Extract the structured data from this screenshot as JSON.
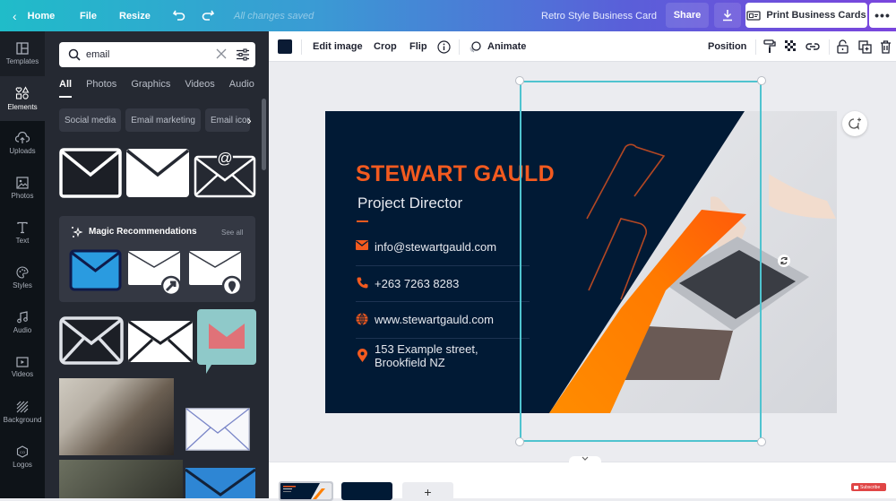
{
  "topbar": {
    "home": "Home",
    "file": "File",
    "resize": "Resize",
    "save_status": "All changes saved",
    "doc_title": "Retro Style Business Card",
    "share": "Share",
    "print": "Print Business Cards",
    "more": "•••"
  },
  "rail": {
    "items": [
      {
        "label": "Templates",
        "icon": "templates-icon"
      },
      {
        "label": "Elements",
        "icon": "elements-icon"
      },
      {
        "label": "Uploads",
        "icon": "upload-cloud-icon"
      },
      {
        "label": "Photos",
        "icon": "photos-icon"
      },
      {
        "label": "Text",
        "icon": "text-icon"
      },
      {
        "label": "Styles",
        "icon": "palette-icon"
      },
      {
        "label": "Audio",
        "icon": "music-icon"
      },
      {
        "label": "Videos",
        "icon": "video-icon"
      },
      {
        "label": "Background",
        "icon": "background-icon"
      },
      {
        "label": "Logos",
        "icon": "logo-icon"
      }
    ]
  },
  "panel": {
    "search_value": "email",
    "tabs": [
      "All",
      "Photos",
      "Graphics",
      "Videos",
      "Audio"
    ],
    "active_tab": "All",
    "chips": [
      "Social media",
      "Email marketing",
      "Email icon"
    ],
    "magic": {
      "title": "Magic Recommendations",
      "see_all": "See all"
    }
  },
  "context_toolbar": {
    "swatch_color": "#0b1b34",
    "edit_image": "Edit image",
    "crop": "Crop",
    "flip": "Flip",
    "animate": "Animate",
    "position": "Position"
  },
  "card": {
    "name": "STEWART GAULD",
    "role": "Project Director",
    "email": "info@stewartgauld.com",
    "phone": "+263 7263 8283",
    "website": "www.stewartgauld.com",
    "address_line1": "153 Example street,",
    "address_line2": "Brookfield NZ",
    "colors": {
      "navy": "#011a35",
      "orange": "#f35a1f"
    }
  },
  "pages": {
    "add": "+"
  },
  "overlay": {
    "subscribe": "Subscribe"
  }
}
